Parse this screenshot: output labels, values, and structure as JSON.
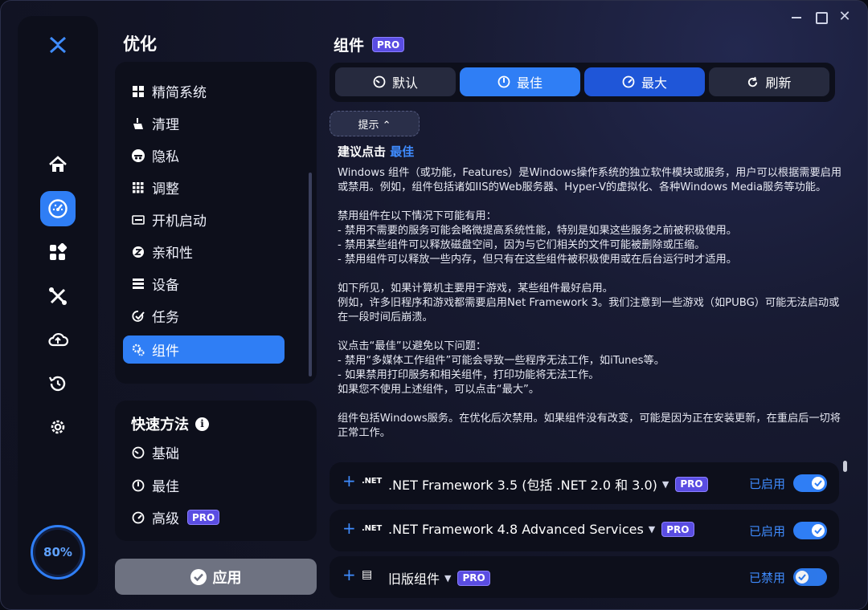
{
  "sidebar": {
    "title": "优化",
    "items": [
      {
        "label": "精简系统",
        "icon": "windows-icon"
      },
      {
        "label": "清理",
        "icon": "broom-icon"
      },
      {
        "label": "隐私",
        "icon": "incognito-icon"
      },
      {
        "label": "调整",
        "icon": "grid-icon"
      },
      {
        "label": "开机启动",
        "icon": "startup-icon"
      },
      {
        "label": "亲和性",
        "icon": "chip-icon"
      },
      {
        "label": "设备",
        "icon": "device-icon"
      },
      {
        "label": "任务",
        "icon": "task-icon"
      },
      {
        "label": "组件",
        "icon": "puzzle-gear-icon",
        "active": true
      }
    ]
  },
  "quick": {
    "title": "快速方法",
    "items": [
      {
        "label": "基础"
      },
      {
        "label": "最佳"
      },
      {
        "label": "高级",
        "pro": "PRO"
      }
    ]
  },
  "apply_label": "应用",
  "gauge": "80%",
  "main": {
    "title": "组件",
    "pro": "PRO",
    "segments": [
      {
        "label": "默认"
      },
      {
        "label": "最佳"
      },
      {
        "label": "最大"
      },
      {
        "label": "刷新"
      }
    ],
    "tip_label": "提示 ⌃",
    "suggest_prefix": "建议点击",
    "suggest_highlight": "最佳",
    "description": "Windows 组件（或功能，Features）是Windows操作系统的独立软件模块或服务，用户可以根据需要启用或禁用。例如，组件包括诸如IIS的Web服务器、Hyper-V的虚拟化、各种Windows Media服务等功能。\n\n禁用组件在以下情况下可能有用：\n- 禁用不需要的服务可能会略微提高系统性能，特别是如果这些服务之前被积极使用。\n- 禁用某些组件可以释放磁盘空间，因为与它们相关的文件可能被删除或压缩。\n- 禁用组件可以释放一些内存，但只有在这些组件被积极使用或在后台运行时才适用。\n\n如下所见，如果计算机主要用于游戏，某些组件最好启用。\n例如，许多旧程序和游戏都需要启用Net Framework 3。我们注意到一些游戏（如PUBG）可能无法启动或在一段时间后崩溃。\n\n议点击“最佳”以避免以下问题：\n- 禁用“多媒体工作组件”可能会导致一些程序无法工作，如iTunes等。\n- 如果禁用打印服务和相关组件，打印功能将无法工作。\n如果您不使用上述组件，可以点击“最大”。\n\n组件包括Windows服务。在优化后次禁用。如果组件没有改变，可能是因为正在安装更新，在重启后一切将正常工作。",
    "components": [
      {
        "icon": ".NET",
        "name": ".NET Framework 3.5 (包括 .NET 2.0 和 3.0)",
        "pro": "PRO",
        "status": "已启用"
      },
      {
        "icon": ".NET",
        "name": ".NET Framework 4.8 Advanced Services",
        "pro": "PRO",
        "status": "已启用"
      },
      {
        "icon": "▤",
        "name": "旧版组件",
        "pro": "PRO",
        "status": "已禁用"
      }
    ]
  }
}
